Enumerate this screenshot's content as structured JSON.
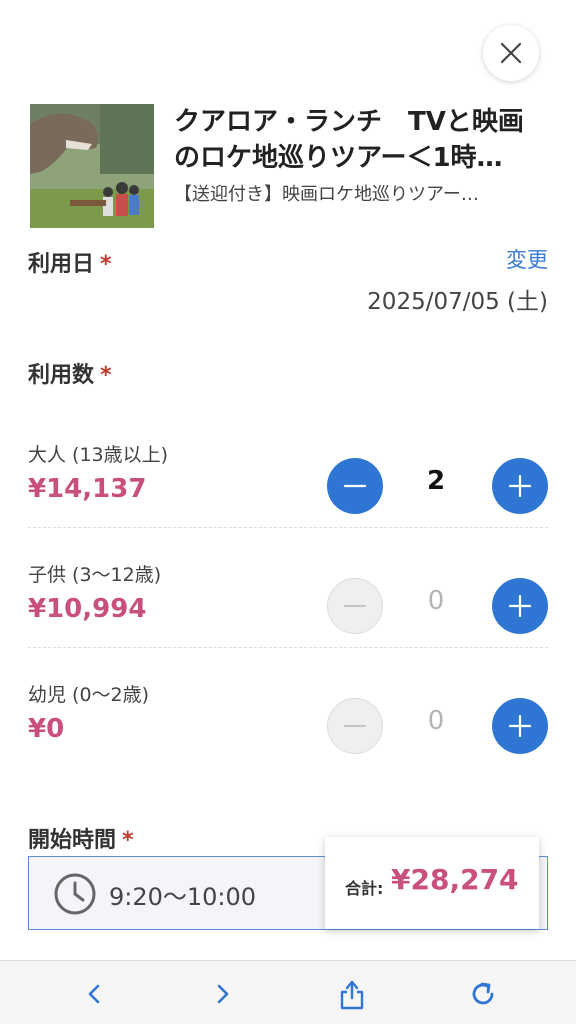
{
  "header": {
    "title_line1": "クアロア・ランチ　TVと映画",
    "title_line2": "のロケ地巡りツアー＜1時…",
    "subtitle": "【送迎付き】映画ロケ地巡りツアー…"
  },
  "date_section": {
    "label": "利用日",
    "required_mark": "*",
    "change_label": "変更",
    "value": "2025/07/05 (土)"
  },
  "quantity_section": {
    "label": "利用数",
    "required_mark": "*",
    "rows": [
      {
        "age": "大人 (13歳以上)",
        "price": "¥14,137",
        "count": "2",
        "minus_enabled": true
      },
      {
        "age": "子供 (3〜12歳)",
        "price": "¥10,994",
        "count": "0",
        "minus_enabled": false
      },
      {
        "age": "幼児 (0〜2歳)",
        "price": "¥0",
        "count": "0",
        "minus_enabled": false
      }
    ]
  },
  "time_section": {
    "label": "開始時間",
    "required_mark": "*",
    "value": "9:20〜10:00"
  },
  "total": {
    "label": "合計:",
    "value": "¥28,274"
  },
  "colors": {
    "accent_blue": "#2f76d4",
    "price_pink": "#c94f7c",
    "link_blue": "#3a7bd5",
    "required_red": "#c0392b"
  },
  "icons": {
    "close": "close-icon",
    "clock": "clock-icon",
    "back": "chevron-left-icon",
    "forward": "chevron-right-icon",
    "share": "share-icon",
    "reload": "reload-icon"
  }
}
